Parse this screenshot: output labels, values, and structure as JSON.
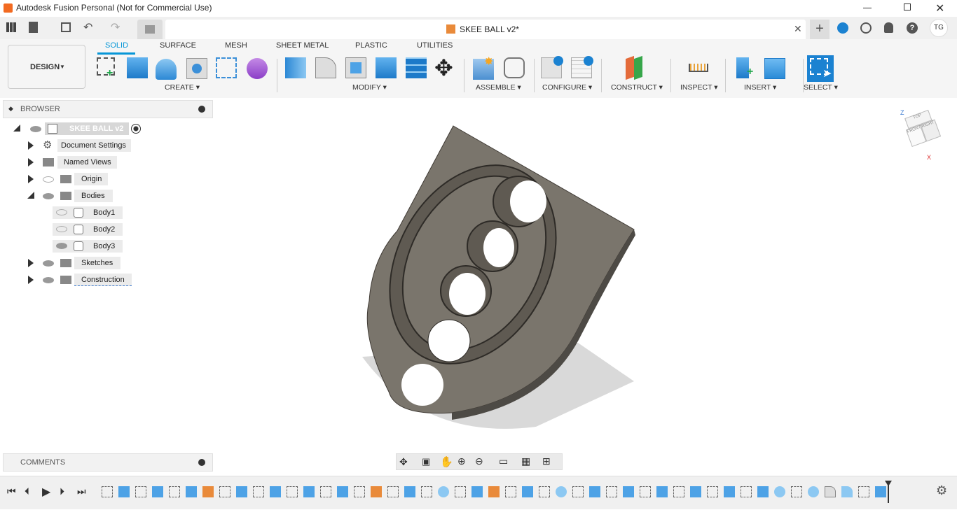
{
  "app": {
    "title": "Autodesk Fusion Personal (Not for Commercial Use)"
  },
  "doc_tab": {
    "name": "SKEE BALL v2*"
  },
  "user": {
    "initials": "TG"
  },
  "workspace": {
    "label": "DESIGN"
  },
  "ribbon_tabs": [
    "SOLID",
    "SURFACE",
    "MESH",
    "SHEET METAL",
    "PLASTIC",
    "UTILITIES"
  ],
  "groups": {
    "create": "CREATE",
    "modify": "MODIFY",
    "assemble": "ASSEMBLE",
    "configure": "CONFIGURE",
    "construct": "CONSTRUCT",
    "inspect": "INSPECT",
    "insert": "INSERT",
    "select": "SELECT"
  },
  "browser": {
    "title": "BROWSER",
    "root": "SKEE BALL v2",
    "items": [
      "Document Settings",
      "Named Views",
      "Origin",
      "Bodies",
      "Body1",
      "Body2",
      "Body3",
      "Sketches",
      "Construction"
    ]
  },
  "comments": {
    "title": "COMMENTS"
  },
  "viewcube": {
    "top": "TOP",
    "front": "FRONT",
    "right": "RIGHT",
    "z": "Z",
    "x": "X"
  }
}
